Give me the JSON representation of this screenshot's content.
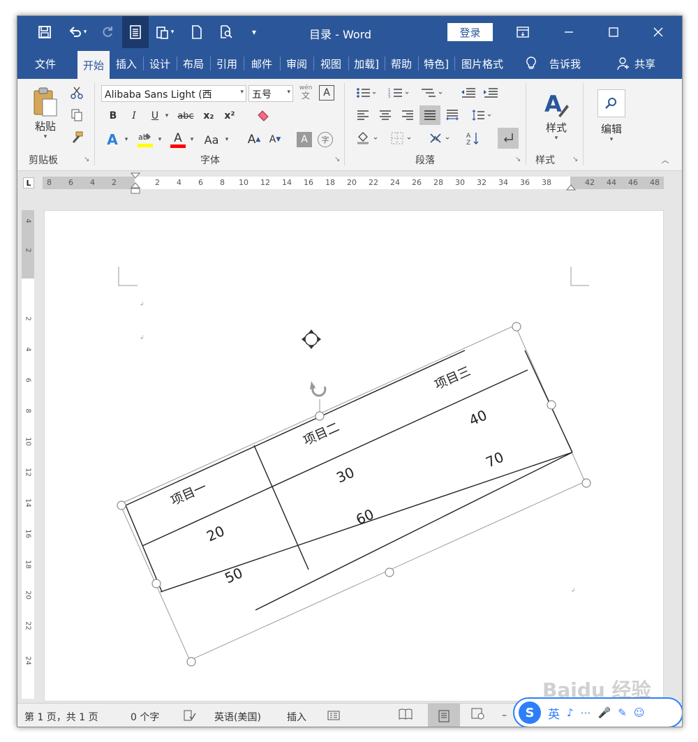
{
  "window": {
    "title": "目录 - Word",
    "login_label": "登录"
  },
  "tabs": [
    {
      "label": "文件"
    },
    {
      "label": "开始"
    },
    {
      "label": "插入"
    },
    {
      "label": "设计"
    },
    {
      "label": "布局"
    },
    {
      "label": "引用"
    },
    {
      "label": "邮件"
    },
    {
      "label": "审阅"
    },
    {
      "label": "视图"
    },
    {
      "label": "加载]"
    },
    {
      "label": "帮助"
    },
    {
      "label": "特色]"
    },
    {
      "label": "图片格式"
    }
  ],
  "tell_me": "告诉我",
  "share": "共享",
  "ribbon": {
    "clipboard": {
      "paste": "粘贴",
      "label": "剪贴板"
    },
    "font": {
      "name": "Alibaba Sans Light (西",
      "size": "五号",
      "label": "字体",
      "bold": "B",
      "italic": "I",
      "underline": "U",
      "strike": "abc",
      "sub": "x₂",
      "sup": "x²",
      "grow": "A",
      "shrink": "A",
      "case": "Aa",
      "wen": "wén",
      "wen_char": "文",
      "border_char": "A",
      "circle_char": "字"
    },
    "paragraph": {
      "label": "段落"
    },
    "styles": {
      "button": "样式",
      "label": "样式"
    },
    "editing": {
      "button": "编辑"
    }
  },
  "ruler": {
    "h_labels": [
      "8",
      "6",
      "4",
      "2",
      "2",
      "4",
      "6",
      "8",
      "10",
      "12",
      "14",
      "16",
      "18",
      "20",
      "22",
      "24",
      "26",
      "28",
      "30",
      "32",
      "34",
      "36",
      "38",
      "42",
      "44",
      "46",
      "48"
    ],
    "v_labels": [
      "4",
      "2",
      "2",
      "4",
      "6",
      "8",
      "10",
      "12",
      "14",
      "16",
      "18",
      "20",
      "22",
      "24"
    ]
  },
  "document": {
    "table": {
      "headers": [
        "项目一",
        "项目二",
        "项目三"
      ],
      "rows": [
        [
          "20",
          "30",
          "40"
        ],
        [
          "50",
          "60",
          "70"
        ]
      ]
    }
  },
  "status": {
    "page": "第 1 页，共 1 页",
    "words": "0 个字",
    "language": "英语(美国)",
    "mode": "插入"
  },
  "ime": {
    "lang": "英"
  },
  "watermark": "Baidu 经验",
  "colors": {
    "title_bar": "#2b579a",
    "ribbon_bg": "#f3f3f3",
    "highlight": "#ffff00",
    "font_color": "#ff0000"
  }
}
